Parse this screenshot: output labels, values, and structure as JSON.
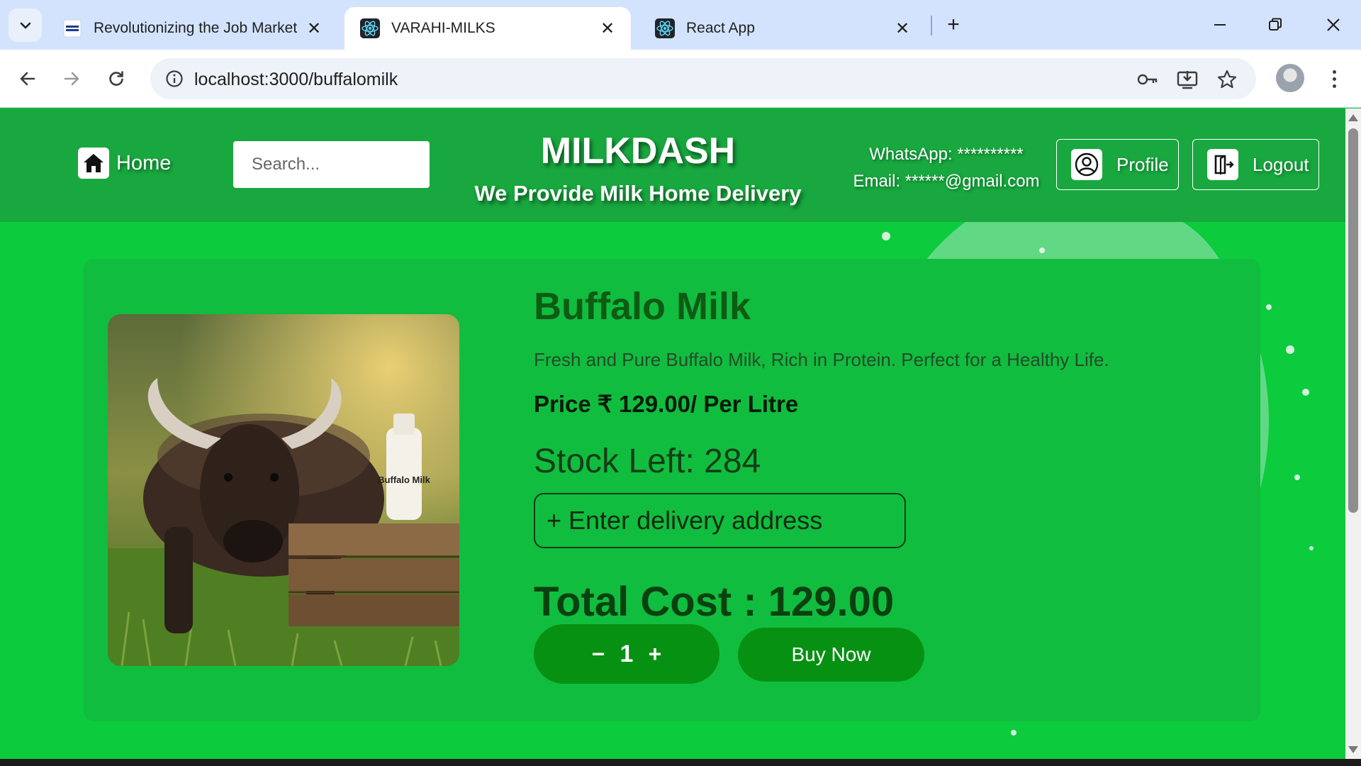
{
  "browser": {
    "tabs": [
      {
        "title": "Revolutionizing the Job Market",
        "favicon": "nxtwave-icon",
        "active": false
      },
      {
        "title": "VARAHI-MILKS",
        "favicon": "react-icon",
        "active": true
      },
      {
        "title": "React App",
        "favicon": "react-icon",
        "active": false
      }
    ],
    "url": "localhost:3000/buffalomilk"
  },
  "header": {
    "home_label": "Home",
    "search_placeholder": "Search...",
    "brand_title": "MILKDASH",
    "brand_subtitle": "We Provide Milk Home Delivery",
    "whatsapp": "WhatsApp: **********",
    "email": "Email: ******@gmail.com",
    "profile_label": "Profile",
    "logout_label": "Logout"
  },
  "product": {
    "image_label": "Buffalo Milk",
    "name": "Buffalo Milk",
    "description": "Fresh and Pure Buffalo Milk, Rich in Protein. Perfect for a Healthy Life.",
    "price": "Price ₹ 129.00/ Per Litre",
    "stock": "Stock Left: 284",
    "address_placeholder": "+ Enter delivery address",
    "total": "Total Cost : 129.00",
    "quantity": "1",
    "decrement": "−",
    "increment": "+",
    "buy_label": "Buy Now"
  },
  "colors": {
    "page_bg": "#0ccb3c",
    "header_bg": "#18a83f",
    "button_bg": "#079113",
    "title_color": "#0e5b14"
  }
}
